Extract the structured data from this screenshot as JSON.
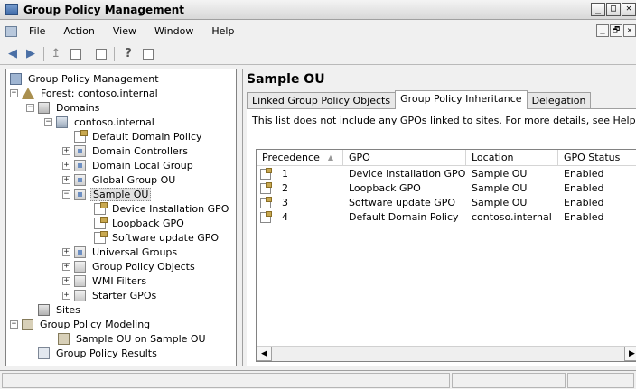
{
  "window": {
    "title": "Group Policy Management",
    "controls": [
      "_",
      "□",
      "✕"
    ]
  },
  "menu": {
    "items": [
      "File",
      "Action",
      "View",
      "Window",
      "Help"
    ],
    "child_controls": [
      "_",
      "🗗",
      "✕"
    ]
  },
  "toolbar": {
    "buttons": [
      "back-icon",
      "forward-icon",
      "up-icon",
      "show-hide-tree-icon",
      "refresh-icon",
      "help-icon",
      "properties-icon"
    ]
  },
  "tree": {
    "root": "Group Policy Management",
    "forest": "Forest: contoso.internal",
    "domains": "Domains",
    "domain": "contoso.internal",
    "default_policy": "Default Domain Policy",
    "domain_controllers": "Domain Controllers",
    "domain_local_group": "Domain Local Group",
    "global_group_ou": "Global Group OU",
    "sample_ou": "Sample OU",
    "gpo_device": "Device Installation GPO",
    "gpo_loopback": "Loopback GPO",
    "gpo_software": "Software update GPO",
    "universal_groups": "Universal Groups",
    "gp_objects": "Group Policy Objects",
    "wmi_filters": "WMI Filters",
    "starter_gpos": "Starter GPOs",
    "sites": "Sites",
    "modeling": "Group Policy Modeling",
    "modeling_item": "Sample OU on Sample OU",
    "results": "Group Policy Results"
  },
  "main": {
    "title": "Sample OU",
    "tabs": [
      "Linked Group Policy Objects",
      "Group Policy Inheritance",
      "Delegation"
    ],
    "active_tab": "Group Policy Inheritance",
    "info": "This list does not include any GPOs linked to sites. For more details, see Help.",
    "columns": [
      "Precedence",
      "GPO",
      "Location",
      "GPO Status"
    ],
    "rows": [
      {
        "precedence": "1",
        "gpo": "Device Installation GPO",
        "location": "Sample OU",
        "status": "Enabled"
      },
      {
        "precedence": "2",
        "gpo": "Loopback GPO",
        "location": "Sample OU",
        "status": "Enabled"
      },
      {
        "precedence": "3",
        "gpo": "Software update GPO",
        "location": "Sample OU",
        "status": "Enabled"
      },
      {
        "precedence": "4",
        "gpo": "Default Domain Policy",
        "location": "contoso.internal",
        "status": "Enabled"
      }
    ]
  },
  "scroll": {
    "left_arrow": "◀",
    "right_arrow": "▶"
  },
  "expanders": {
    "collapse": "−",
    "expand": "+"
  },
  "header_sort": "▲"
}
